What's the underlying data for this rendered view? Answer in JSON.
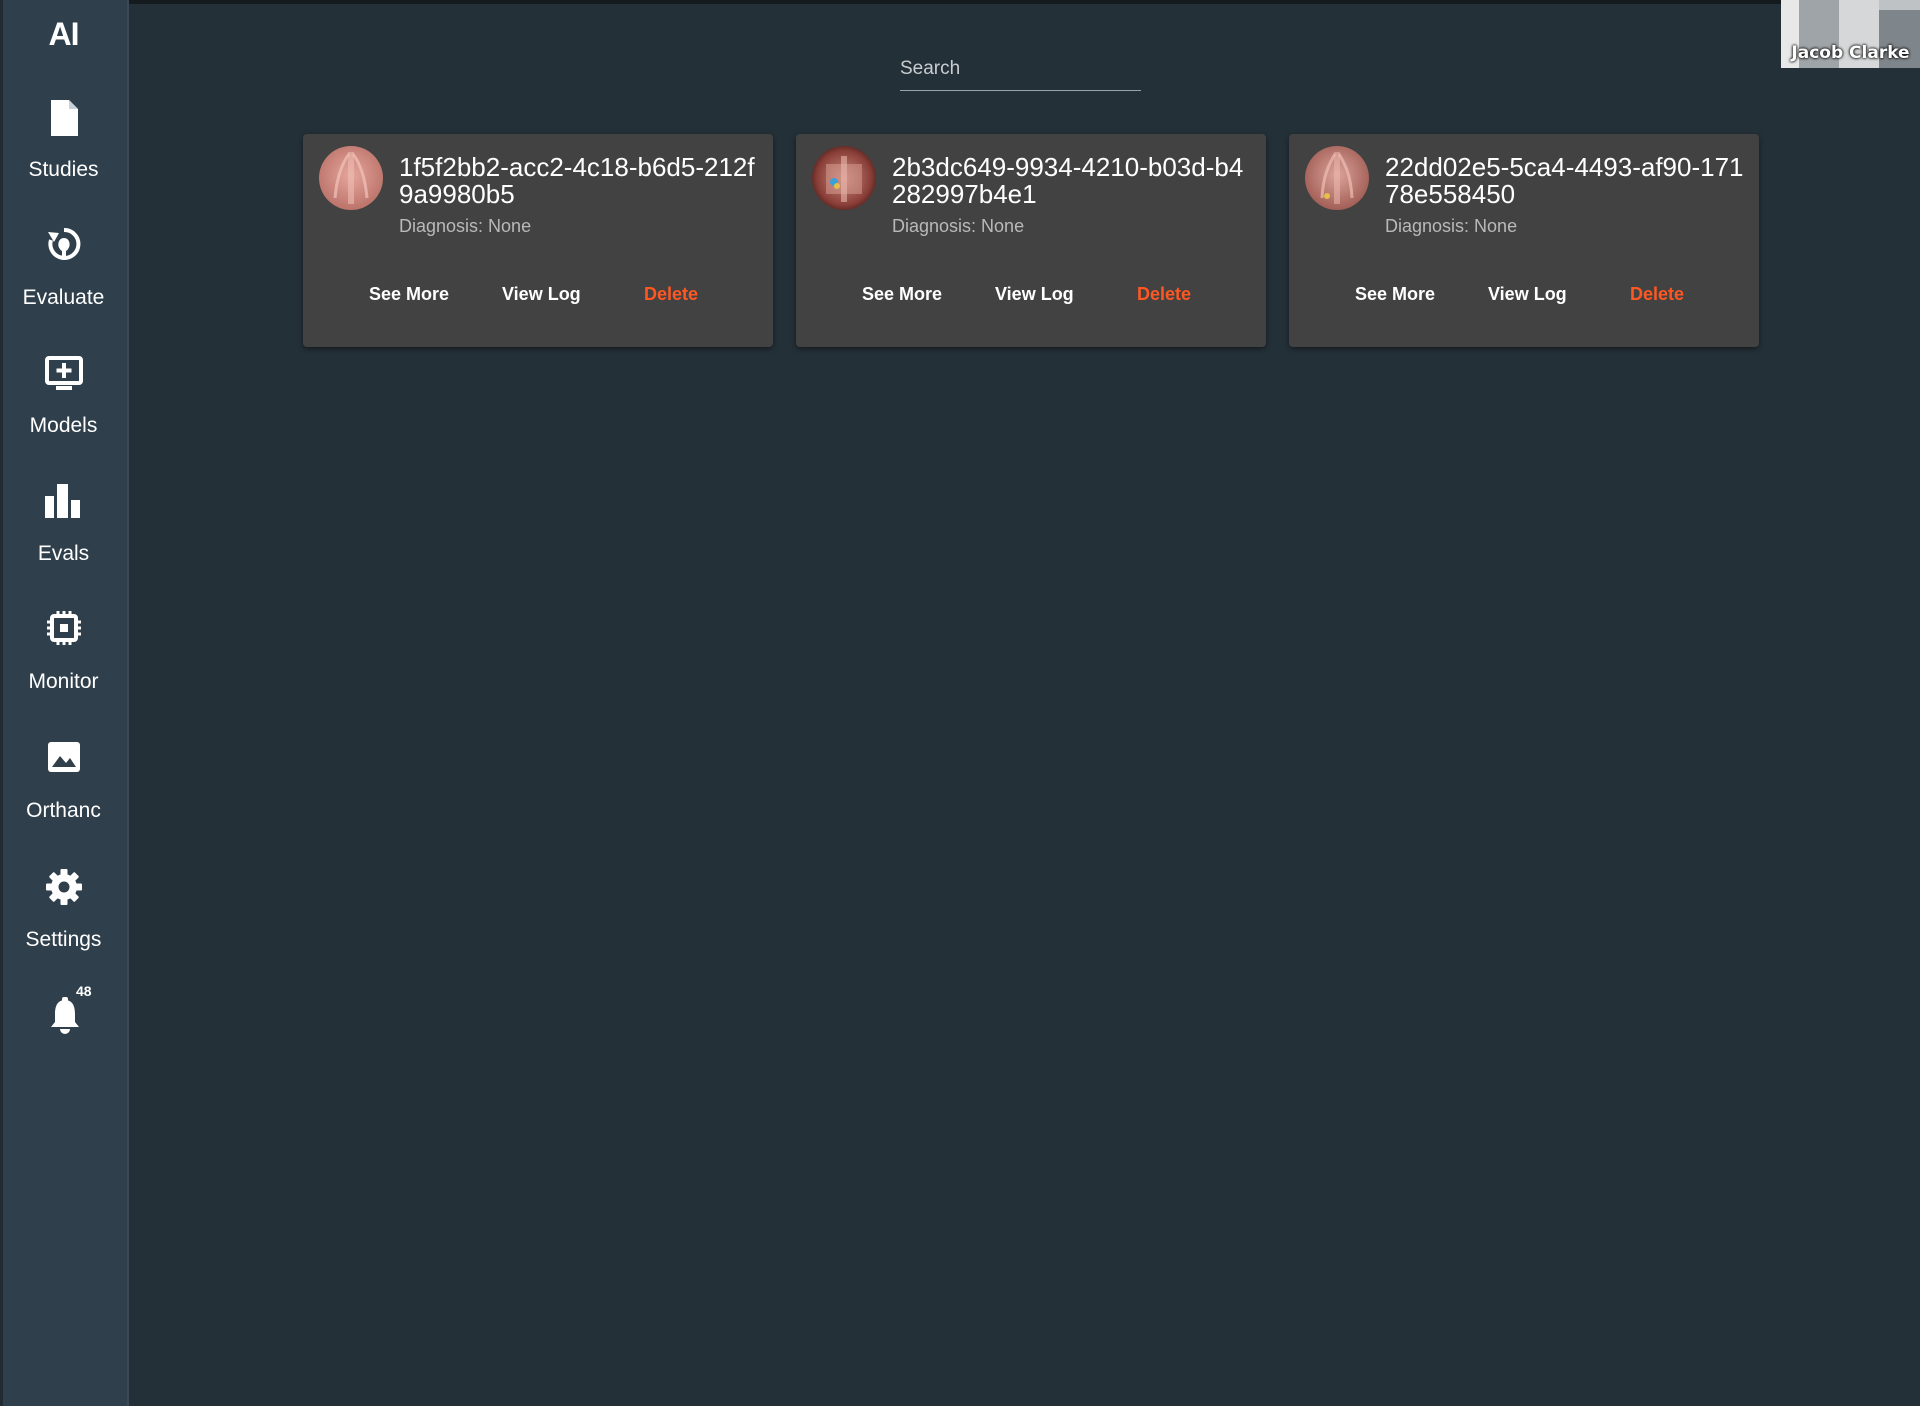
{
  "app": {
    "logo": "AI"
  },
  "sidebar": {
    "items": [
      {
        "label": "Studies",
        "icon": "file-icon"
      },
      {
        "label": "Evaluate",
        "icon": "brain-refresh-icon"
      },
      {
        "label": "Models",
        "icon": "monitor-add-icon"
      },
      {
        "label": "Evals",
        "icon": "bar-chart-icon"
      },
      {
        "label": "Monitor",
        "icon": "cpu-chip-icon"
      },
      {
        "label": "Orthanc",
        "icon": "image-icon"
      },
      {
        "label": "Settings",
        "icon": "gear-icon"
      }
    ],
    "notifications": {
      "icon": "bell-icon",
      "count": "48"
    }
  },
  "search": {
    "placeholder": "Search",
    "value": ""
  },
  "studies": [
    {
      "id": "1f5f2bb2-acc2-4c18-b6d5-212f9a9980b5",
      "diagnosis": "Diagnosis: None",
      "actions": {
        "see_more": "See More",
        "view_log": "View Log",
        "delete": "Delete"
      }
    },
    {
      "id": "2b3dc649-9934-4210-b03d-b4282997b4e1",
      "diagnosis": "Diagnosis: None",
      "actions": {
        "see_more": "See More",
        "view_log": "View Log",
        "delete": "Delete"
      }
    },
    {
      "id": "22dd02e5-5ca4-4493-af90-17178e558450",
      "diagnosis": "Diagnosis: None",
      "actions": {
        "see_more": "See More",
        "view_log": "View Log",
        "delete": "Delete"
      }
    }
  ],
  "video_overlay": {
    "name": "Jacob Clarke"
  },
  "colors": {
    "background": "#243038",
    "sidebar": "#2f3f4b",
    "card": "#424242",
    "danger": "#ff5722"
  }
}
